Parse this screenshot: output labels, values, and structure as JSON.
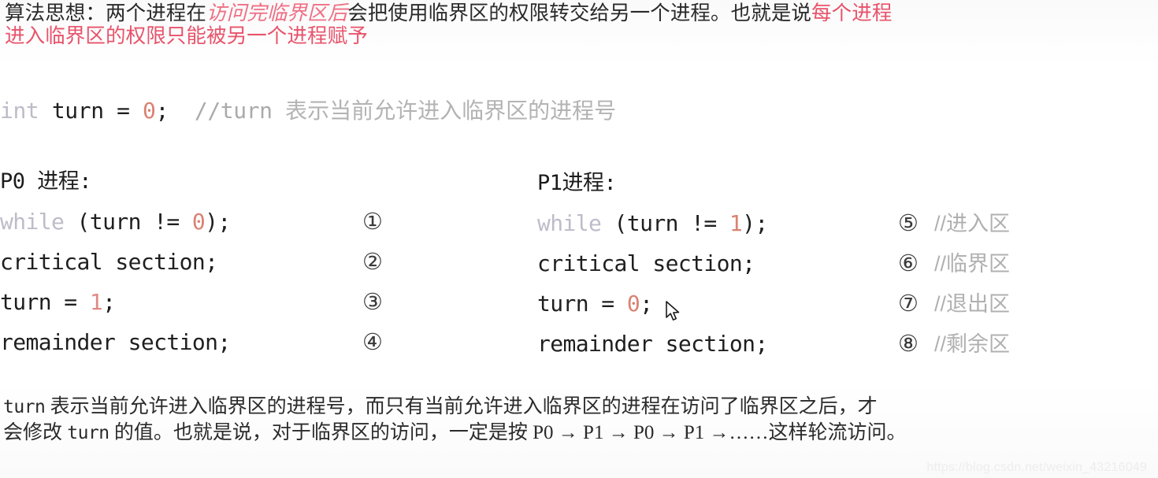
{
  "heading": {
    "line1_a": "算法思想：两个进程在",
    "line1_em": "访问完临界区后",
    "line1_b": "会把使用临界区的权限转交给另一个进程。也就是说",
    "line1_red": "每个进程",
    "line2_red": "进入临界区的权限只能被另一个进程赋予"
  },
  "declaration": {
    "keyword": "int",
    "rest": " turn = ",
    "value": "0",
    "semicolon": ";  ",
    "comment_code": "//turn ",
    "comment_cn": "表示当前允许进入临界区的进程号"
  },
  "p0": {
    "title": "P0 进程:",
    "rows": [
      {
        "kw": "while",
        "code": " (turn != ",
        "num": "0",
        "tail": ");",
        "marker": "①",
        "comment": ""
      },
      {
        "kw": "",
        "code": "critical section;",
        "num": "",
        "tail": "",
        "marker": "②",
        "comment": ""
      },
      {
        "kw": "",
        "code": "turn = ",
        "num": "1",
        "tail": ";",
        "marker": "③",
        "comment": ""
      },
      {
        "kw": "",
        "code": "remainder section;",
        "num": "",
        "tail": "",
        "marker": "④",
        "comment": ""
      }
    ]
  },
  "p1": {
    "title": "P1进程:",
    "rows": [
      {
        "kw": "while",
        "code": " (turn != ",
        "num": "1",
        "tail": ");",
        "marker": "⑤",
        "comment": "//进入区"
      },
      {
        "kw": "",
        "code": "critical section;",
        "num": "",
        "tail": "",
        "marker": "⑥",
        "comment": "//临界区"
      },
      {
        "kw": "",
        "code": "turn = ",
        "num": "0",
        "tail": ";",
        "marker": "⑦",
        "comment": "//退出区"
      },
      {
        "kw": "",
        "code": "remainder section;",
        "num": "",
        "tail": "",
        "marker": "⑧",
        "comment": "//剩余区"
      }
    ]
  },
  "footer": {
    "line1_mono": "turn",
    "line1_text": " 表示当前允许进入临界区的进程号，而只有当前允许进入临界区的进程在访问了临界区之后，才",
    "line2_a": "会修改 ",
    "line2_mono": "turn",
    "line2_b": " 的值。也就是说，对于临界区的访问，一定是按 P0 → P1 → P0 → P1 →……这样轮流访问。"
  },
  "watermark": "https://blog.csdn.net/weixin_43216049",
  "colors": {
    "accent_red": "#e8536b",
    "accent_red_italic": "#ef6f84",
    "number_literal": "#d98272",
    "keyword_faded": "#bdbcc9",
    "comment_gray": "#b0b0b0",
    "text_dark": "#1f1f1f",
    "background": "#fdfdfd"
  }
}
